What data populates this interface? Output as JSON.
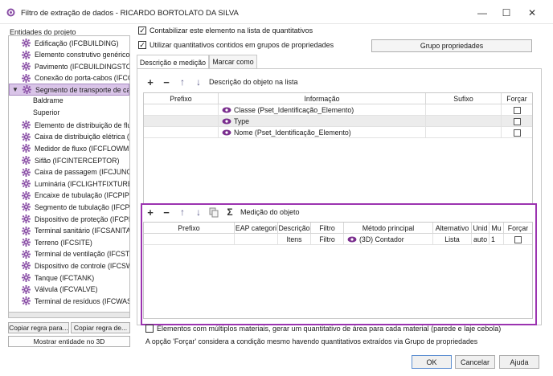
{
  "window": {
    "title": "Filtro de extração de dados - RICARDO BORTOLATO DA SILVA",
    "minimize": "—",
    "maximize": "☐",
    "close": "✕"
  },
  "left_panel": {
    "label": "Entidades do projeto",
    "items": [
      {
        "label": "Edificação (IFCBUILDING)",
        "icon": "gear-icon"
      },
      {
        "label": "Elemento construtivo genérico (I",
        "icon": "gear-icon"
      },
      {
        "label": "Pavimento (IFCBUILDINGSTOREY",
        "icon": "gear-icon"
      },
      {
        "label": "Conexão do porta-cabos (IFCCAI",
        "icon": "gear-icon"
      },
      {
        "label": "Segmento de transporte de cabo",
        "icon": "gear-icon",
        "selected": true,
        "expanded": true
      }
    ],
    "children": [
      "Baldrame",
      "Superior"
    ],
    "items_after": [
      {
        "label": "Elemento de distribuição de flux",
        "icon": "gear-icon"
      },
      {
        "label": "Caixa de distribuição elétrica (IFC",
        "icon": "gear-icon"
      },
      {
        "label": "Medidor de fluxo (IFCFLOWMETI",
        "icon": "gear-icon"
      },
      {
        "label": "Sifão (IFCINTERCEPTOR)",
        "icon": "gear-icon"
      },
      {
        "label": "Caixa de passagem (IFCJUNCTIO",
        "icon": "gear-icon"
      },
      {
        "label": "Luminária (IFCLIGHTFIXTURE)",
        "icon": "gear-icon"
      },
      {
        "label": "Encaixe de tubulação (IFCPIPEFIT",
        "icon": "gear-icon"
      },
      {
        "label": "Segmento de tubulação (IFCPIPE",
        "icon": "gear-icon"
      },
      {
        "label": "Dispositivo de proteção (IFCPRO",
        "icon": "gear-icon"
      },
      {
        "label": "Terminal sanitário (IFCSANITARY",
        "icon": "gear-icon"
      },
      {
        "label": "Terreno (IFCSITE)",
        "icon": "gear-icon"
      },
      {
        "label": "Terminal de ventilação (IFCSTACI",
        "icon": "gear-icon"
      },
      {
        "label": "Dispositivo de controle (IFCSWIT",
        "icon": "gear-icon"
      },
      {
        "label": "Tanque (IFCTANK)",
        "icon": "gear-icon"
      },
      {
        "label": "Válvula (IFCVALVE)",
        "icon": "gear-icon"
      },
      {
        "label": "Terminal de resíduos (IFCWASTE",
        "icon": "gear-icon"
      }
    ],
    "copy_rule_1": "Copiar regra para...",
    "copy_rule_2": "Copiar regra de...",
    "show_3d": "Mostrar entidade no 3D"
  },
  "options": {
    "count_element": "Contabilizar este elemento na lista de quantitativos",
    "use_property_groups": "Utilizar quantitativos contidos em grupos de propriedades",
    "property_groups_button": "Grupo propriedades"
  },
  "tabs": {
    "description": "Descrição e medição",
    "mark_as": "Marcar como"
  },
  "description_section": {
    "toolbar_label": "Descrição do objeto na lista",
    "headers": [
      "Prefixo",
      "Informação",
      "Sufixo",
      "Forçar"
    ],
    "rows": [
      {
        "info": "Classe (Pset_Identificação_Elemento)"
      },
      {
        "info": "Type"
      },
      {
        "info": "Nome (Pset_Identificação_Elemento)"
      }
    ]
  },
  "measurement_section": {
    "toolbar_label": "Medição do objeto",
    "headers": [
      "Prefixo",
      "EAP categori",
      "Descrição",
      "Filtro",
      "Método principal",
      "Alternativo",
      "Unid",
      "Mu",
      "Forçar"
    ],
    "row": {
      "descricao": "Itens",
      "filtro": "Filtro",
      "metodo": "(3D) Contador",
      "alternativo": "Lista",
      "unid": "auto",
      "mu": "1"
    }
  },
  "bottom": {
    "multi_material": "Elementos com múltiplos materiais, gerar um quantitativo de área para cada material (parede e laje cebola)",
    "force_note": "A opção 'Forçar' considera a condição mesmo havendo quantitativos extraídos via Grupo de propriedades"
  },
  "dialog_buttons": {
    "ok": "OK",
    "cancel": "Cancelar",
    "help": "Ajuda"
  },
  "colors": {
    "highlight": "#9b33b0",
    "selected_item": "#d9c4e8",
    "gear": "#8a4fa6"
  }
}
